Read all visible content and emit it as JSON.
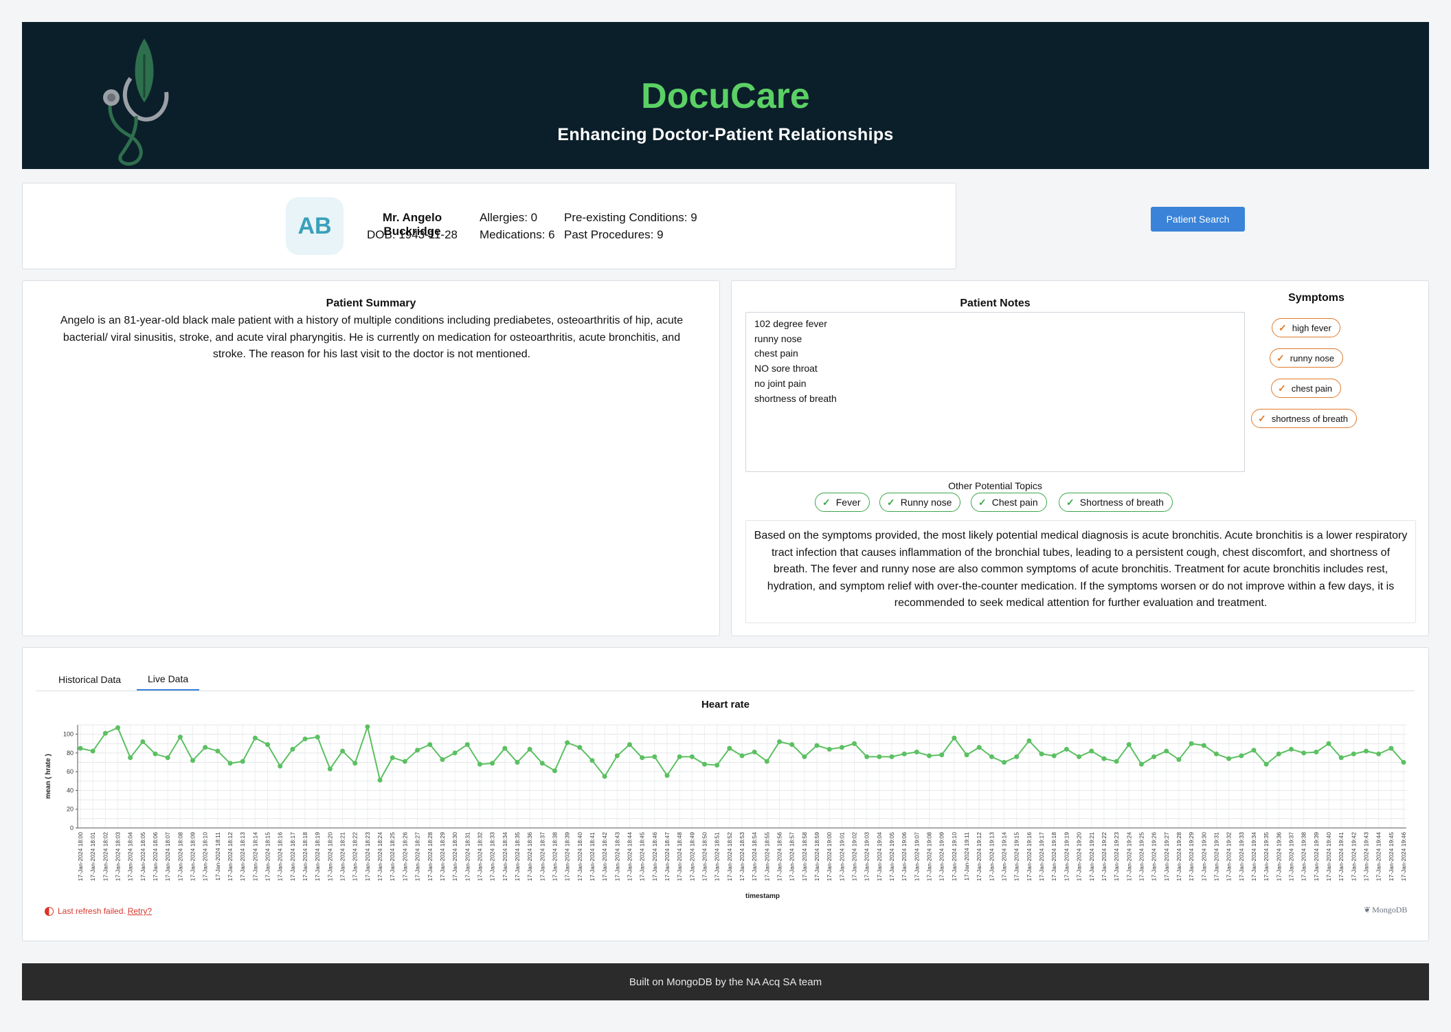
{
  "header": {
    "title": "DocuCare",
    "subtitle": "Enhancing Doctor-Patient Relationships"
  },
  "patient": {
    "initials": "AB",
    "name": "Mr. Angelo Buckridge",
    "dob": "DOB: 1943-11-28",
    "allergies": "Allergies: 0",
    "medications": "Medications: 6",
    "conditions": "Pre-existing Conditions: 9",
    "procedures": "Past Procedures: 9",
    "search_label": "Patient Search"
  },
  "summary": {
    "title": "Patient Summary",
    "text": "Angelo is an 81-year-old black male patient with a history of multiple conditions including prediabetes, osteoarthritis of hip, acute bacterial/ viral sinusitis, stroke, and acute viral pharyngitis. He is currently on medication for osteoarthritis, acute bronchitis, and stroke. The reason for his last visit to the doctor is not mentioned."
  },
  "notes": {
    "title": "Patient Notes",
    "text": "102 degree fever\nrunny nose\nchest pain\nNO sore throat\nno joint pain\nshortness of breath",
    "symptoms_title": "Symptoms",
    "symptoms": [
      "high fever",
      "runny nose",
      "chest pain",
      "shortness of breath"
    ],
    "topics_title": "Other Potential Topics",
    "topics": [
      "Fever",
      "Runny nose",
      "Chest pain",
      "Shortness of breath"
    ],
    "diagnosis": "Based on the symptoms provided, the most likely potential medical diagnosis is acute bronchitis. Acute bronchitis is a lower respiratory tract infection that causes inflammation of the bronchial tubes, leading to a persistent cough, chest discomfort, and shortness of breath. The fever and runny nose are also common symptoms of acute bronchitis. Treatment for acute bronchitis includes rest, hydration, and symptom relief with over-the-counter medication. If the symptoms worsen or do not improve within a few days, it is recommended to seek medical attention for further evaluation and treatment."
  },
  "tabs": {
    "historical": "Historical Data",
    "live": "Live Data",
    "active": "live"
  },
  "chart_status": {
    "refresh_text": "Last refresh failed.",
    "retry_label": "Retry?",
    "watermark": "MongoDB"
  },
  "footer": {
    "text": "Built on MongoDB by the NA Acq SA team"
  },
  "colors": {
    "header_bg": "#0b1f2a",
    "brand_green": "#5bd165",
    "symptom_chip": "#e07a2b",
    "topic_chip": "#3aa64a",
    "button_blue": "#3a83d8",
    "line_green": "#5bc061"
  },
  "chart_data": {
    "type": "line",
    "title": "Heart rate",
    "xlabel": "timestamp",
    "ylabel": "mean ( hrate )",
    "ylim": [
      0,
      110
    ],
    "yticks": [
      0,
      20,
      40,
      60,
      80,
      100
    ],
    "grid": true,
    "x": [
      "17-Jan-2024 18:00",
      "17-Jan-2024 18:01",
      "17-Jan-2024 18:02",
      "17-Jan-2024 18:03",
      "17-Jan-2024 18:04",
      "17-Jan-2024 18:05",
      "17-Jan-2024 18:06",
      "17-Jan-2024 18:07",
      "17-Jan-2024 18:08",
      "17-Jan-2024 18:09",
      "17-Jan-2024 18:10",
      "17-Jan-2024 18:11",
      "17-Jan-2024 18:12",
      "17-Jan-2024 18:13",
      "17-Jan-2024 18:14",
      "17-Jan-2024 18:15",
      "17-Jan-2024 18:16",
      "17-Jan-2024 18:17",
      "17-Jan-2024 18:18",
      "17-Jan-2024 18:19",
      "17-Jan-2024 18:20",
      "17-Jan-2024 18:21",
      "17-Jan-2024 18:22",
      "17-Jan-2024 18:23",
      "17-Jan-2024 18:24",
      "17-Jan-2024 18:25",
      "17-Jan-2024 18:26",
      "17-Jan-2024 18:27",
      "17-Jan-2024 18:28",
      "17-Jan-2024 18:29",
      "17-Jan-2024 18:30",
      "17-Jan-2024 18:31",
      "17-Jan-2024 18:32",
      "17-Jan-2024 18:33",
      "17-Jan-2024 18:34",
      "17-Jan-2024 18:35",
      "17-Jan-2024 18:36",
      "17-Jan-2024 18:37",
      "17-Jan-2024 18:38",
      "17-Jan-2024 18:39",
      "17-Jan-2024 18:40",
      "17-Jan-2024 18:41",
      "17-Jan-2024 18:42",
      "17-Jan-2024 18:43",
      "17-Jan-2024 18:44",
      "17-Jan-2024 18:45",
      "17-Jan-2024 18:46",
      "17-Jan-2024 18:47",
      "17-Jan-2024 18:48",
      "17-Jan-2024 18:49",
      "17-Jan-2024 18:50",
      "17-Jan-2024 18:51",
      "17-Jan-2024 18:52",
      "17-Jan-2024 18:53",
      "17-Jan-2024 18:54",
      "17-Jan-2024 18:55",
      "17-Jan-2024 18:56",
      "17-Jan-2024 18:57",
      "17-Jan-2024 18:58",
      "17-Jan-2024 18:59",
      "17-Jan-2024 19:00",
      "17-Jan-2024 19:01",
      "17-Jan-2024 19:02",
      "17-Jan-2024 19:03",
      "17-Jan-2024 19:04",
      "17-Jan-2024 19:05",
      "17-Jan-2024 19:06",
      "17-Jan-2024 19:07",
      "17-Jan-2024 19:08",
      "17-Jan-2024 19:09",
      "17-Jan-2024 19:10",
      "17-Jan-2024 19:11",
      "17-Jan-2024 19:12",
      "17-Jan-2024 19:13",
      "17-Jan-2024 19:14",
      "17-Jan-2024 19:15",
      "17-Jan-2024 19:16",
      "17-Jan-2024 19:17",
      "17-Jan-2024 19:18",
      "17-Jan-2024 19:19",
      "17-Jan-2024 19:20",
      "17-Jan-2024 19:21",
      "17-Jan-2024 19:22",
      "17-Jan-2024 19:23",
      "17-Jan-2024 19:24",
      "17-Jan-2024 19:25",
      "17-Jan-2024 19:26",
      "17-Jan-2024 19:27",
      "17-Jan-2024 19:28",
      "17-Jan-2024 19:29",
      "17-Jan-2024 19:30",
      "17-Jan-2024 19:31",
      "17-Jan-2024 19:32",
      "17-Jan-2024 19:33",
      "17-Jan-2024 19:34",
      "17-Jan-2024 19:35",
      "17-Jan-2024 19:36",
      "17-Jan-2024 19:37",
      "17-Jan-2024 19:38",
      "17-Jan-2024 19:39",
      "17-Jan-2024 19:40",
      "17-Jan-2024 19:41",
      "17-Jan-2024 19:42",
      "17-Jan-2024 19:43",
      "17-Jan-2024 19:44",
      "17-Jan-2024 19:45",
      "17-Jan-2024 19:46"
    ],
    "series": [
      {
        "values": [
          85,
          82,
          101,
          107,
          75,
          92,
          79,
          75,
          97,
          72,
          86,
          82,
          69,
          71,
          96,
          89,
          66,
          84,
          95,
          97,
          63,
          82,
          69,
          108,
          51,
          75,
          71,
          83,
          89,
          73,
          80,
          89,
          68,
          69,
          85,
          70,
          84,
          69,
          61,
          91,
          86,
          72,
          55,
          77,
          89,
          75,
          76,
          56,
          76,
          76,
          68,
          67,
          85,
          77,
          81,
          71,
          92,
          89,
          76,
          88,
          84,
          86,
          90,
          76,
          76,
          76,
          79,
          81,
          77,
          78,
          96,
          78,
          86,
          76,
          70,
          76,
          93,
          79,
          77,
          84,
          76,
          82,
          74,
          71,
          89,
          68,
          76,
          82,
          73,
          90,
          88,
          79,
          74,
          77,
          83,
          68,
          79,
          84,
          80,
          81,
          90,
          75,
          79,
          82,
          79,
          85,
          70
        ]
      }
    ]
  }
}
